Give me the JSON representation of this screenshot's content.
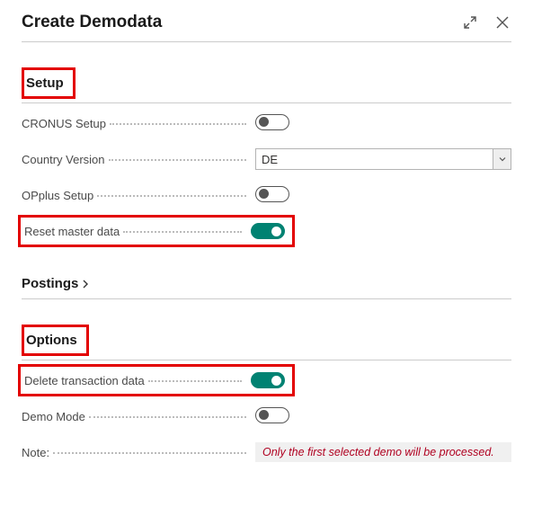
{
  "header": {
    "title": "Create Demodata"
  },
  "sections": {
    "setup": {
      "title": "Setup",
      "cronus_setup_label": "CRONUS Setup",
      "cronus_setup_value": false,
      "country_version_label": "Country Version",
      "country_version_value": "DE",
      "opplus_setup_label": "OPplus Setup",
      "opplus_setup_value": false,
      "reset_master_label": "Reset master data",
      "reset_master_value": true
    },
    "postings": {
      "title": "Postings"
    },
    "options": {
      "title": "Options",
      "delete_transaction_label": "Delete transaction data",
      "delete_transaction_value": true,
      "demo_mode_label": "Demo Mode",
      "demo_mode_value": false,
      "note_label": "Note:",
      "note_text": "Only the first selected demo will be processed."
    }
  }
}
